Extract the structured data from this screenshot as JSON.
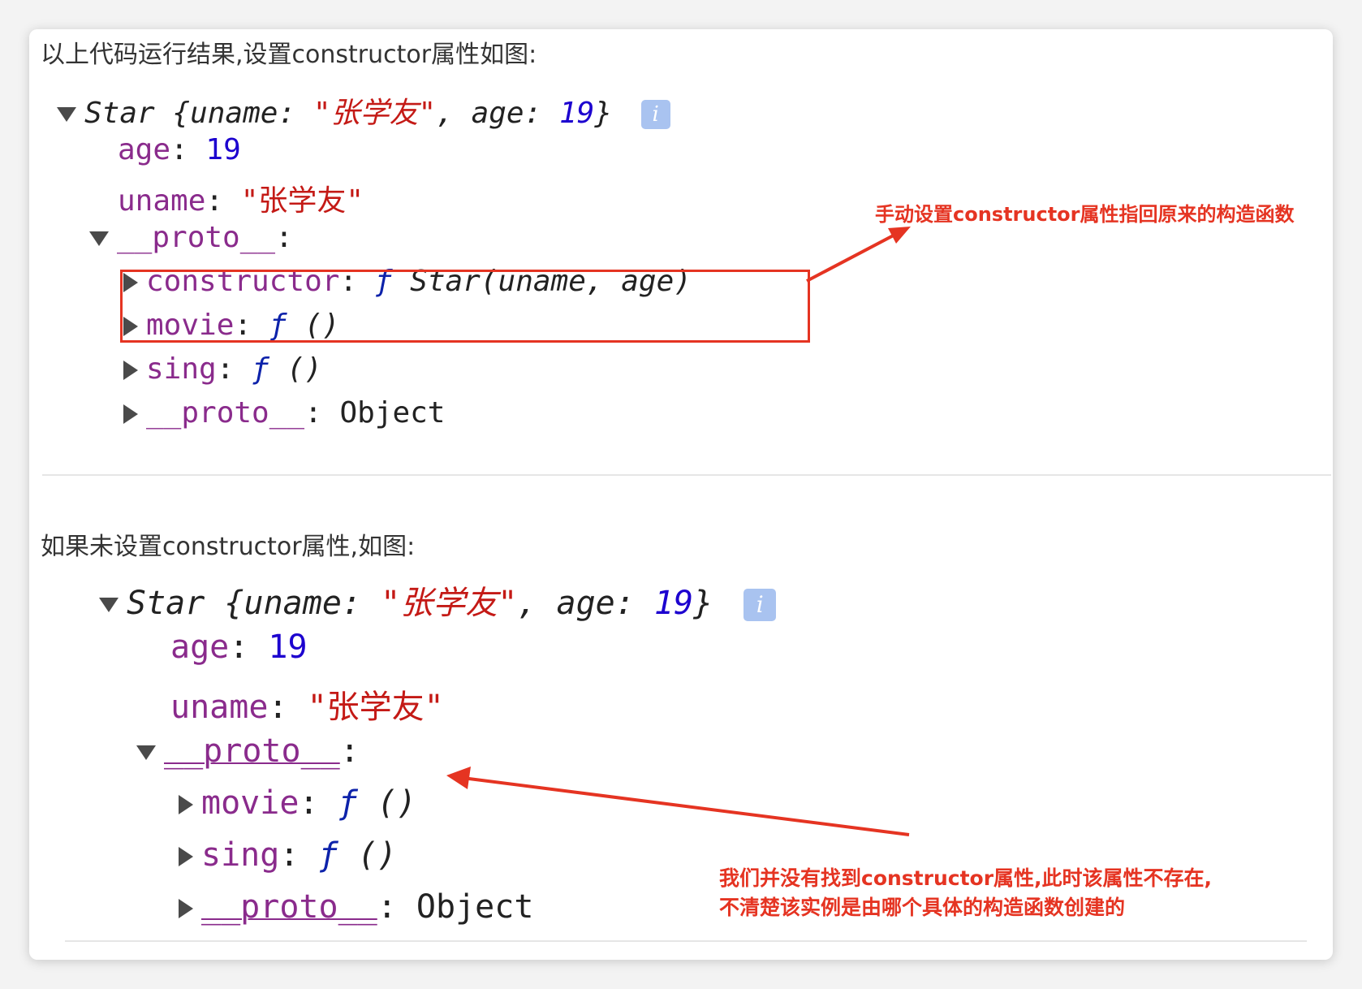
{
  "section1": {
    "caption": "以上代码运行结果,设置constructor属性如图:",
    "header": {
      "class_name": "Star",
      "open_brace": "{",
      "k1": "uname",
      "colon": ":",
      "v1": "\"张学友\"",
      "comma": ",",
      "k2": "age",
      "v2": "19",
      "close_brace": "}",
      "info": "i"
    },
    "age_key": "age",
    "age_val": "19",
    "uname_key": "uname",
    "uname_val": "\"张学友\"",
    "proto_key": "__proto__",
    "constructor_key": "constructor",
    "constructor_f": "ƒ",
    "constructor_val": "Star(uname, age)",
    "movie_key": "movie",
    "f": "ƒ",
    "paren": "()",
    "sing_key": "sing",
    "proto2_key": "__proto__",
    "proto2_val": "Object",
    "annotation": "手动设置constructor属性指回原来的构造函数"
  },
  "section2": {
    "caption": "如果未设置constructor属性,如图:",
    "header": {
      "class_name": "Star",
      "open_brace": "{",
      "k1": "uname",
      "colon": ":",
      "v1": "\"张学友\"",
      "comma": ",",
      "k2": "age",
      "v2": "19",
      "close_brace": "}",
      "info": "i"
    },
    "age_key": "age",
    "age_val": "19",
    "uname_key": "uname",
    "uname_val": "\"张学友\"",
    "proto_key": "__proto__",
    "movie_key": "movie",
    "f": "ƒ",
    "paren": "()",
    "sing_key": "sing",
    "proto2_key": "__proto__",
    "proto2_val": "Object",
    "annotation_line1": "我们并没有找到constructor属性,此时该属性不存在,",
    "annotation_line2": "不清楚该实例是由哪个具体的构造函数创建的"
  },
  "colors": {
    "annotation": "#e53422",
    "property": "#8a2b8c",
    "string": "#c41a16",
    "number": "#1c00cf",
    "function": "#0d22aa"
  }
}
